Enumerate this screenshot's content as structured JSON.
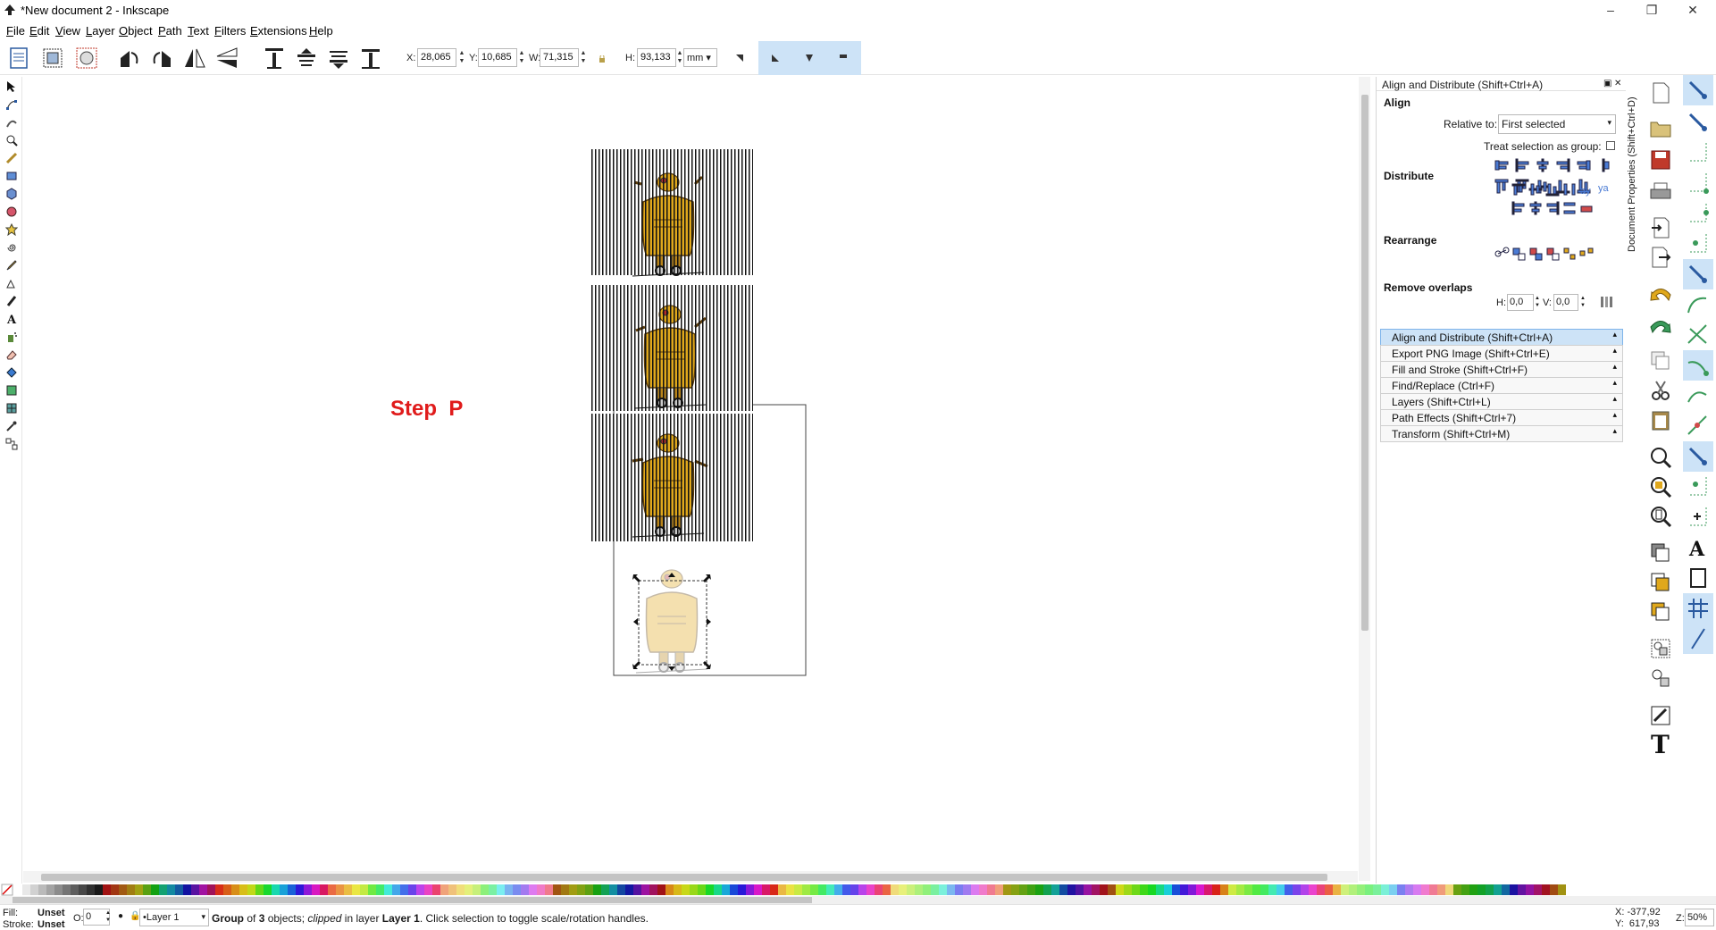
{
  "window": {
    "title": "*New document 2 - Inkscape",
    "minimize": "–",
    "maximize": "❐",
    "close": "✕"
  },
  "menu": [
    "File",
    "Edit",
    "View",
    "Layer",
    "Object",
    "Path",
    "Text",
    "Filters",
    "Extensions",
    "Help"
  ],
  "toolbar": {
    "x_label": "X:",
    "x_value": "28,065",
    "y_label": "Y:",
    "y_value": "10,685",
    "w_label": "W:",
    "w_value": "71,315",
    "h_label": "H:",
    "h_value": "93,133",
    "unit": "mm"
  },
  "canvas": {
    "step_text": "Step  P",
    "text_color": "#e01b1b"
  },
  "dock": {
    "title": "Align and Distribute (Shift+Ctrl+A)",
    "align_heading": "Align",
    "relative_to_label": "Relative to:",
    "relative_to_value": "First selected",
    "treat_as_group_label": "Treat selection as group:",
    "distribute_heading": "Distribute",
    "rearrange_heading": "Rearrange",
    "remove_overlaps_heading": "Remove overlaps",
    "h_label": "H:",
    "h_value": "0,0",
    "v_label": "V:",
    "v_value": "0,0",
    "vertical_tab": "Document Properties (Shift+Ctrl+D)",
    "panels": [
      "Align and Distribute (Shift+Ctrl+A)",
      "Export PNG Image (Shift+Ctrl+E)",
      "Fill and Stroke (Shift+Ctrl+F)",
      "Find/Replace (Ctrl+F)",
      "Layers (Shift+Ctrl+L)",
      "Path Effects  (Shift+Ctrl+7)",
      "Transform (Shift+Ctrl+M)"
    ]
  },
  "status": {
    "fill_label": "Fill:",
    "fill_value": "Unset",
    "stroke_label": "Stroke:",
    "stroke_value": "Unset",
    "opacity_label": "O:",
    "opacity_value": "0",
    "layer": "•Layer 1",
    "message_group": "Group",
    "message_part1": " of ",
    "message_count": "3",
    "message_part2": " objects; ",
    "message_clipped": "clipped",
    "message_part3": " in layer ",
    "message_layer": "Layer 1",
    "message_part4": ". Click selection to toggle scale/rotation handles.",
    "cursor_x": "X: -377,92",
    "cursor_y": "Y:  617,93",
    "zoom_label": "Z:",
    "zoom_value": "50%"
  },
  "colors": {
    "accent": "#cde3f7",
    "robot_body": "#e0a81c",
    "robot_dark": "#8a5a10"
  }
}
